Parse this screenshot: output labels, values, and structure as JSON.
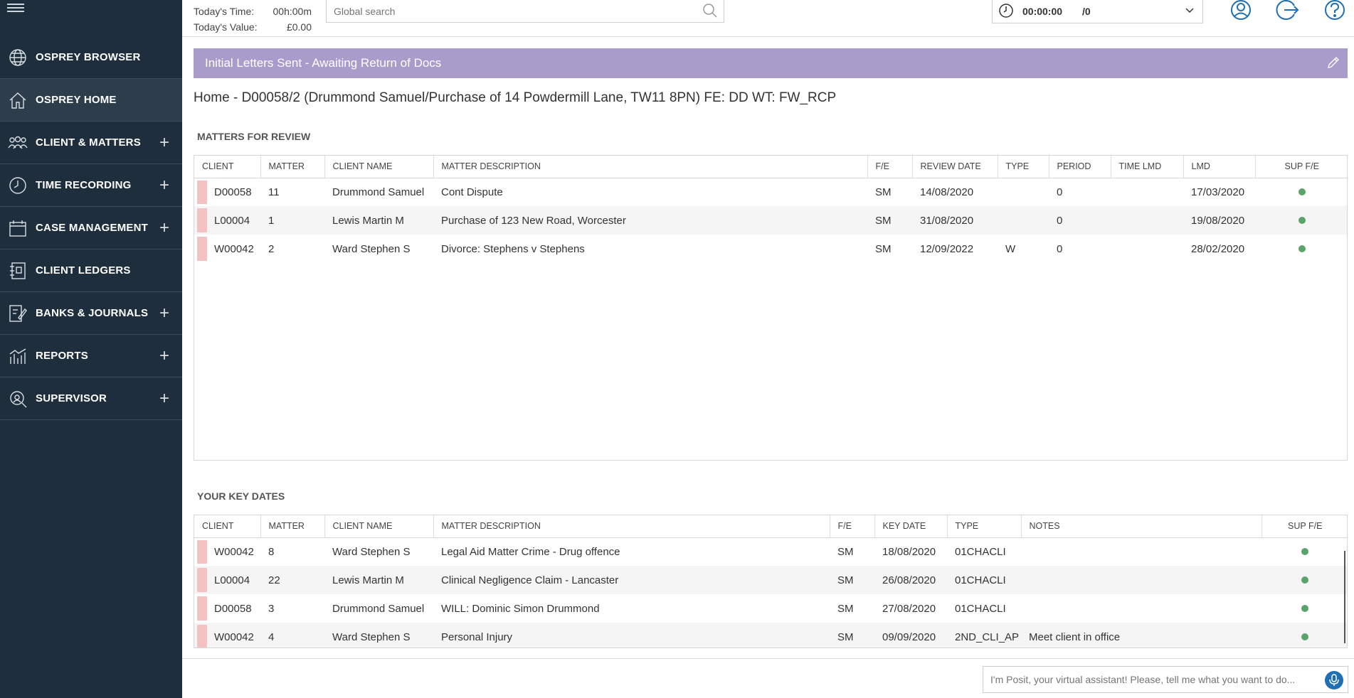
{
  "colors": {
    "sidebar": "#1f2e3c",
    "banner": "#a99cca",
    "accent": "#1f6fb2",
    "status_green": "#5aa469",
    "row_marker": "#f4c2c2"
  },
  "sidebar": {
    "items": [
      {
        "label": "OSPREY BROWSER",
        "icon": "globe-icon",
        "expandable": false
      },
      {
        "label": "OSPREY HOME",
        "icon": "home-icon",
        "expandable": false
      },
      {
        "label": "CLIENT & MATTERS",
        "icon": "people-icon",
        "expandable": true
      },
      {
        "label": "TIME RECORDING",
        "icon": "clock-icon",
        "expandable": true
      },
      {
        "label": "CASE MANAGEMENT",
        "icon": "calendar-icon",
        "expandable": true
      },
      {
        "label": "CLIENT LEDGERS",
        "icon": "ledger-icon",
        "expandable": false
      },
      {
        "label": "BANKS & JOURNALS",
        "icon": "bank-icon",
        "expandable": true
      },
      {
        "label": "REPORTS",
        "icon": "chart-icon",
        "expandable": true
      },
      {
        "label": "SUPERVISOR",
        "icon": "supervisor-icon",
        "expandable": true
      }
    ]
  },
  "header": {
    "todays_time_label": "Today's Time:",
    "todays_time_value": "00h:00m",
    "todays_value_label": "Today's Value:",
    "todays_value_value": "£0.00",
    "search_placeholder": "Global search",
    "timer_value": "00:00:00",
    "timer_count": "/0"
  },
  "banner": {
    "text": "Initial Letters Sent - Awaiting Return of Docs"
  },
  "page_title": "Home - D00058/2 (Drummond  Samuel/Purchase of 14 Powdermill Lane, TW11 8PN) FE: DD WT: FW_RCP",
  "matters": {
    "title": "MATTERS FOR REVIEW",
    "columns": [
      "CLIENT",
      "MATTER",
      "CLIENT NAME",
      "MATTER DESCRIPTION",
      "F/E",
      "REVIEW DATE",
      "TYPE",
      "PERIOD",
      "TIME LMD",
      "LMD",
      "SUP F/E"
    ],
    "rows": [
      [
        "D00058",
        "11",
        "Drummond Samuel",
        "Cont Dispute",
        "SM",
        "14/08/2020",
        "",
        "0",
        "",
        "17/03/2020"
      ],
      [
        "L00004",
        "1",
        "Lewis Martin M",
        "Purchase of 123 New Road, Worcester",
        "SM",
        "31/08/2020",
        "",
        "0",
        "",
        "19/08/2020"
      ],
      [
        "W00042",
        "2",
        "Ward Stephen S",
        "Divorce: Stephens v Stephens",
        "SM",
        "12/09/2022",
        "W",
        "0",
        "",
        "28/02/2020"
      ]
    ]
  },
  "key_dates": {
    "title": "YOUR KEY DATES",
    "columns": [
      "CLIENT",
      "MATTER",
      "CLIENT NAME",
      "MATTER DESCRIPTION",
      "F/E",
      "KEY DATE",
      "TYPE",
      "NOTES",
      "SUP F/E"
    ],
    "rows": [
      [
        "W00042",
        "8",
        "Ward Stephen S",
        "Legal Aid Matter Crime - Drug offence",
        "SM",
        "18/08/2020",
        "01CHACLI",
        ""
      ],
      [
        "L00004",
        "22",
        "Lewis Martin M",
        "Clinical Negligence Claim - Lancaster",
        "SM",
        "26/08/2020",
        "01CHACLI",
        ""
      ],
      [
        "D00058",
        "3",
        "Drummond Samuel",
        "WILL: Dominic Simon Drummond",
        "SM",
        "27/08/2020",
        "01CHACLI",
        ""
      ],
      [
        "W00042",
        "4",
        "Ward Stephen S",
        "Personal Injury",
        "SM",
        "09/09/2020",
        "2ND_CLI_AP",
        "Meet client in office"
      ]
    ]
  },
  "assistant": {
    "placeholder": "I'm Posit, your virtual assistant! Please, tell me what you want to do..."
  }
}
